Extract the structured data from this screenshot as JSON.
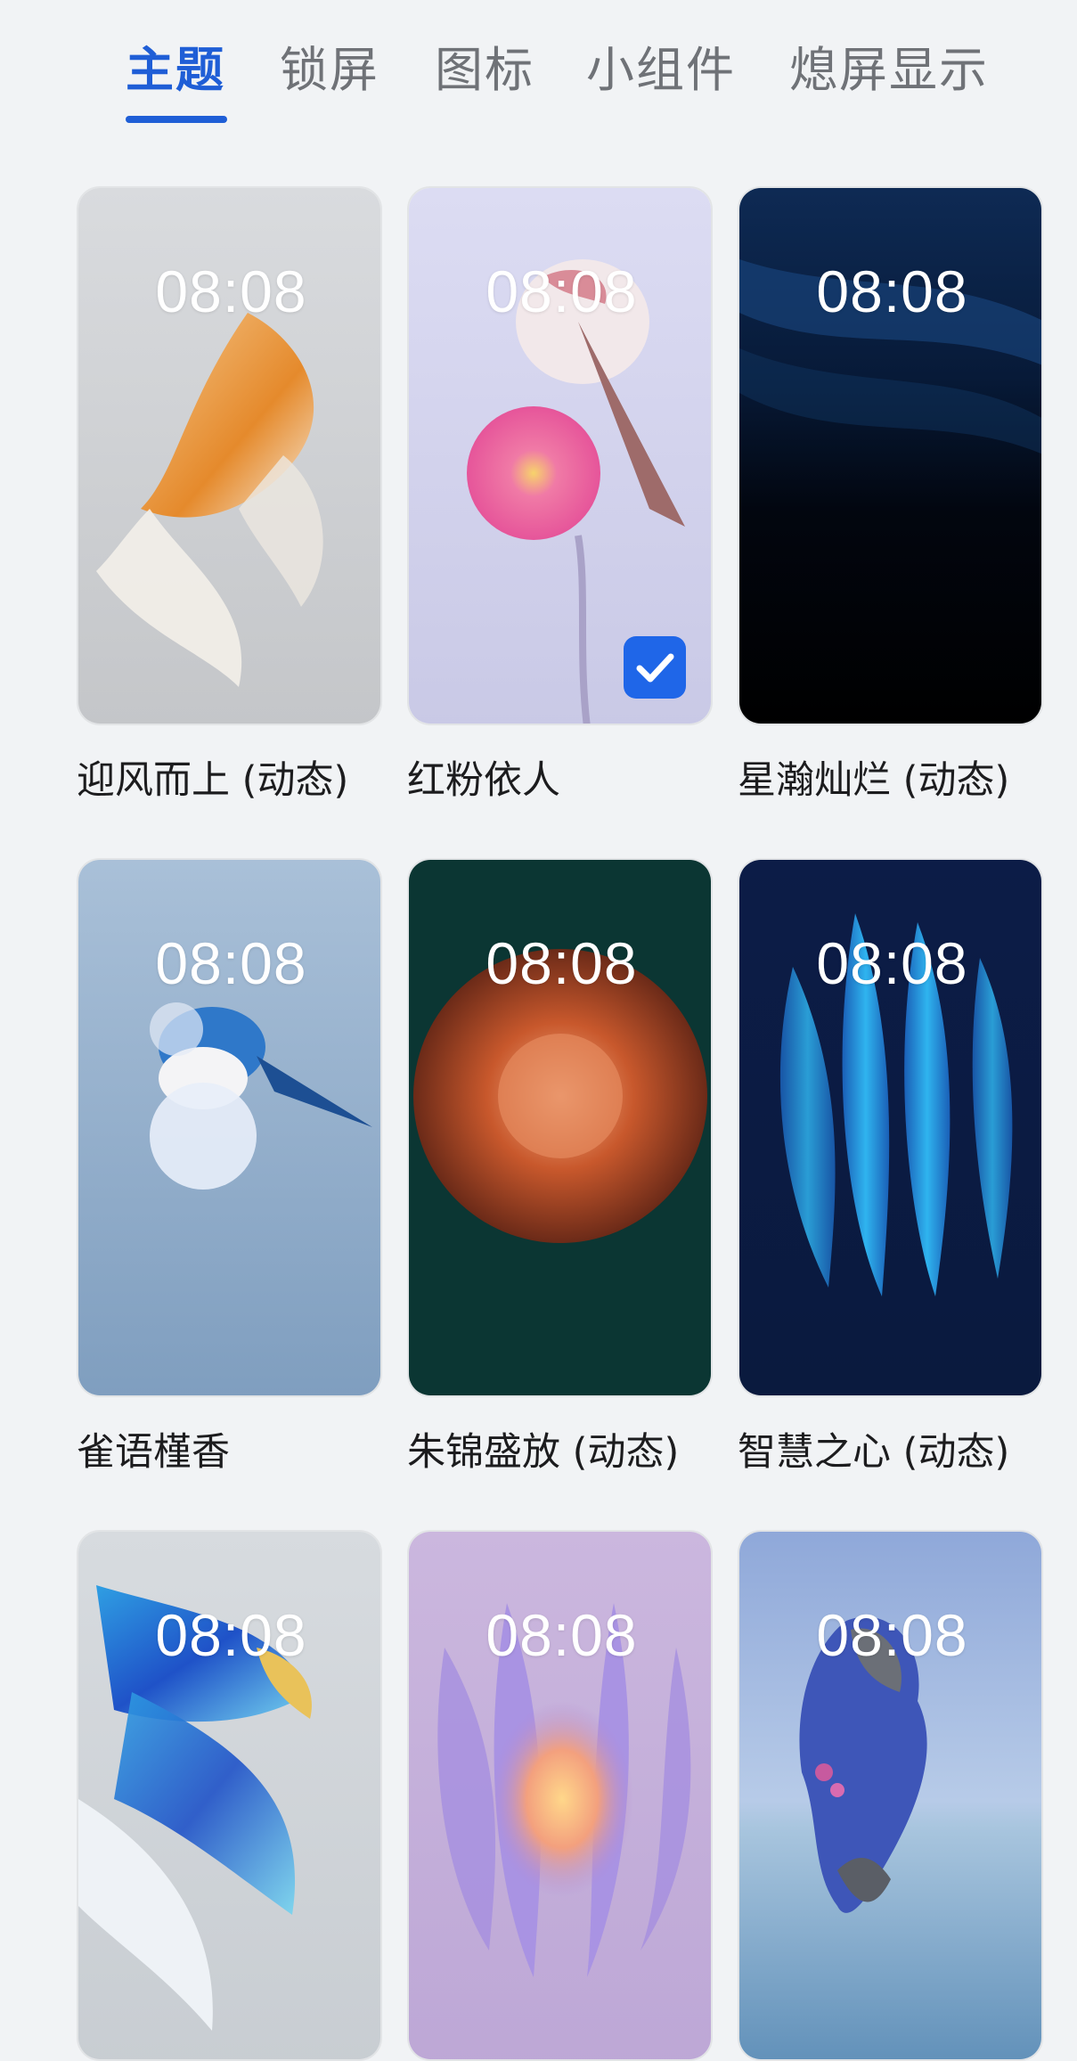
{
  "tabs": [
    {
      "label": "主题"
    },
    {
      "label": "锁屏"
    },
    {
      "label": "图标"
    },
    {
      "label": "小组件"
    },
    {
      "label": "熄屏显示"
    }
  ],
  "active_tab": "主题",
  "accent_color": "#1f5ed6",
  "themes": [
    {
      "name": "迎风而上 (动态)",
      "clock": "08:08",
      "selected": false
    },
    {
      "name": "红粉依人",
      "clock": "08:08",
      "selected": true
    },
    {
      "name": "星瀚灿烂 (动态)",
      "clock": "08:08",
      "selected": false
    },
    {
      "name": "雀语槿香",
      "clock": "08:08",
      "selected": false
    },
    {
      "name": "朱锦盛放 (动态)",
      "clock": "08:08",
      "selected": false
    },
    {
      "name": "智慧之心 (动态)",
      "clock": "08:08",
      "selected": false
    },
    {
      "name": "",
      "clock": "08:08",
      "selected": false
    },
    {
      "name": "",
      "clock": "08:08",
      "selected": false
    },
    {
      "name": "",
      "clock": "08:08",
      "selected": false
    }
  ],
  "icons": {
    "selected_check": "checkmark-icon"
  }
}
